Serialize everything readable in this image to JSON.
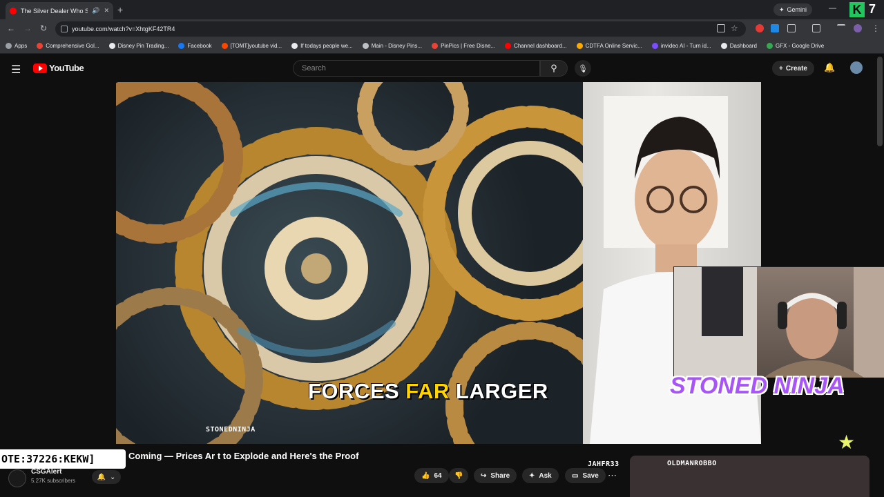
{
  "browser": {
    "tab_title": "The Silver Dealer Who Saw",
    "tab_audio_icon": "speaker-icon",
    "tab_close": "✕",
    "new_tab": "+",
    "gemini_label": "Gemini",
    "extension_badge": "K",
    "extension_count": "7",
    "url": "youtube.com/watch?v=XhtgKF42TR4"
  },
  "bookmarks": [
    {
      "label": "Apps",
      "color": "#9aa0a6"
    },
    {
      "label": "Comprehensive Gol...",
      "color": "#ea4335"
    },
    {
      "label": "Disney Pin Trading...",
      "color": "#e8eaed"
    },
    {
      "label": "Facebook",
      "color": "#1877f2"
    },
    {
      "label": "[TOMT]youtube vid...",
      "color": "#ff4500"
    },
    {
      "label": "If todays people we...",
      "color": "#e8eaed"
    },
    {
      "label": "Main - Disney Pins...",
      "color": "#bdc1c6"
    },
    {
      "label": "PinPics | Free Disne...",
      "color": "#ea4335"
    },
    {
      "label": "Channel dashboard...",
      "color": "#ff0000"
    },
    {
      "label": "CDTFA Online Servic...",
      "color": "#f9ab00"
    },
    {
      "label": "invideo AI - Turn id...",
      "color": "#7c4dff"
    },
    {
      "label": "Dashboard",
      "color": "#e8eaed"
    },
    {
      "label": "GFX - Google Drive",
      "color": "#34a853"
    }
  ],
  "youtube": {
    "logo_text": "YouTube",
    "search_placeholder": "Search",
    "create_label": "Create"
  },
  "video": {
    "subtitle_pre": "FORCES ",
    "subtitle_highlight": "FAR",
    "subtitle_post": " LARGER",
    "streamer_overlay": "STONED NINJA",
    "overlay_tag_1": "STONEDNINJA",
    "overlay_tag_2": "JAHFR33",
    "overlay_tag_3": "OLDMANROBBO",
    "chat_command": "OTE:37226:KEKW]",
    "title": "Coming — Prices Ar   t to Explode and Here's the Proof",
    "channel_name": "CSGAlert",
    "channel_subs": "5.27K subscribers",
    "likes": "64",
    "share_label": "Share",
    "ask_label": "Ask",
    "save_label": "Save"
  }
}
